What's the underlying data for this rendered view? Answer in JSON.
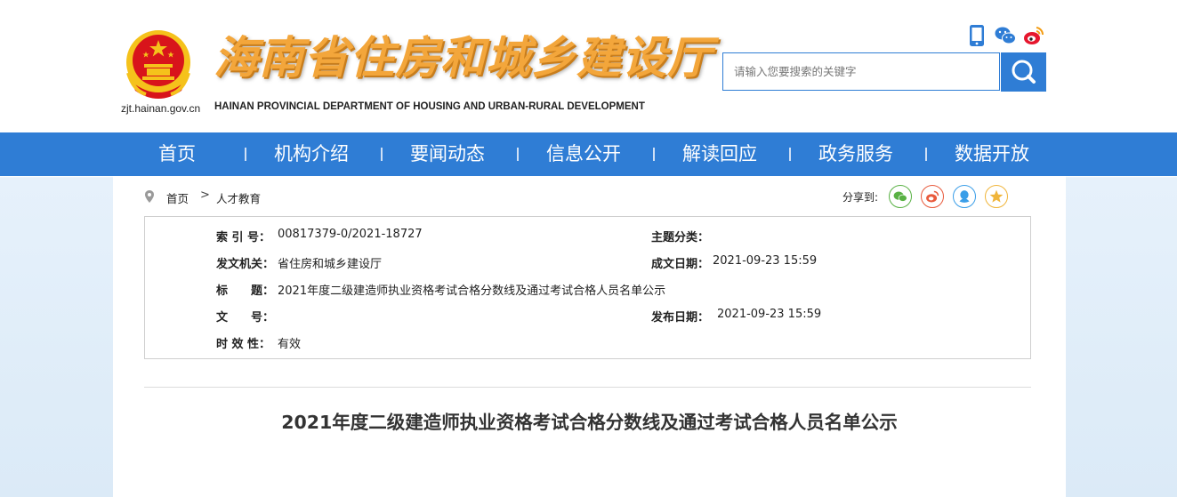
{
  "header": {
    "site_title": "海南省住房和城乡建设厅",
    "site_subtitle": "HAINAN PROVINCIAL DEPARTMENT OF HOUSING AND URBAN-RURAL DEVELOPMENT",
    "site_domain": "zjt.hainan.gov.cn",
    "search_placeholder": "请输入您要搜索的关键字",
    "icons": [
      "mobile-icon",
      "wechat-icon",
      "weibo-icon",
      "search-icon"
    ]
  },
  "nav": {
    "items": [
      {
        "label": "首页"
      },
      {
        "label": "机构介绍"
      },
      {
        "label": "要闻动态"
      },
      {
        "label": "信息公开"
      },
      {
        "label": "解读回应"
      },
      {
        "label": "政务服务"
      },
      {
        "label": "数据开放"
      }
    ]
  },
  "breadcrumb": {
    "home": "首页",
    "separator": ">",
    "current": "人才教育"
  },
  "share": {
    "label": "分享到:",
    "icons": [
      "wechat-icon",
      "weibo-icon",
      "qq-icon",
      "qzone-icon"
    ]
  },
  "meta": {
    "index_label": "索 引 号：",
    "index_value": "00817379-0/2021-18727",
    "topic_label": "主题分类：",
    "topic_value": "",
    "issuer_label": "发文机关：",
    "issuer_value": "省住房和城乡建设厅",
    "created_label": "成文日期：",
    "created_value": "2021-09-23 15:59",
    "title_label": "标　　题：",
    "title_value": "2021年度二级建造师执业资格考试合格分数线及通过考试合格人员名单公示",
    "docno_label": "文　　号：",
    "docno_value": "",
    "published_label": "发布日期：",
    "published_value": "2021-09-23 15:59",
    "validity_label": "时 效 性：",
    "validity_value": "有效"
  },
  "article": {
    "title": "2021年度二级建造师执业资格考试合格分数线及通过考试合格人员名单公示"
  },
  "colors": {
    "brand_blue": "#2f7dd5",
    "title_orange": "#f3a63b",
    "emblem_red": "#d8141b",
    "emblem_gold": "#f5c21b"
  }
}
